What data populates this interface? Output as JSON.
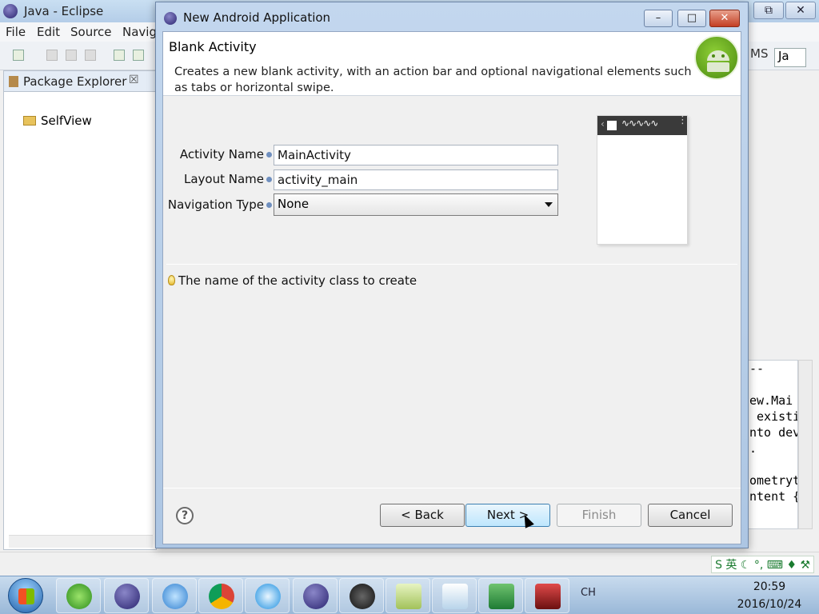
{
  "eclipse": {
    "title": "Java - Eclipse",
    "menu": [
      "File",
      "Edit",
      "Source",
      "Navig"
    ],
    "package_explorer": {
      "tab": "Package Explorer",
      "close": "☒",
      "items": [
        "SelfView"
      ]
    },
    "perspective_label": "MS",
    "perspective_btn": "Ja",
    "code_snippet": "--\n\new.Mai\n existi\nnto dev\n.\n\nometryt\nntent {",
    "window_buttons": {
      "restore": "⧉",
      "close": "✕"
    }
  },
  "dialog": {
    "title": "New Android Application",
    "buttons": {
      "minimize": "–",
      "maximize": "□",
      "close": "✕"
    },
    "header": {
      "title": "Blank Activity",
      "description": "Creates a new blank activity, with an action bar and optional navigational elements such as tabs or horizontal swipe."
    },
    "form": {
      "activity_name_label": "Activity Name",
      "activity_name_value": "MainActivity",
      "layout_name_label": "Layout Name",
      "layout_name_value": "activity_main",
      "navigation_type_label": "Navigation Type",
      "navigation_type_value": "None"
    },
    "preview": {
      "chevron": "‹",
      "wave": "∿∿∿∿∿",
      "menu_dots": "⋮"
    },
    "hint": "The name of the activity class to create",
    "footer": {
      "help": "?",
      "back": "< Back",
      "next": "Next >",
      "finish": "Finish",
      "cancel": "Cancel"
    }
  },
  "taskbar": {
    "language": "CH",
    "ime": "S 英 ☾ °, ⌨ ♦ ⚒",
    "time": "20:59",
    "date": "2016/10/24"
  }
}
